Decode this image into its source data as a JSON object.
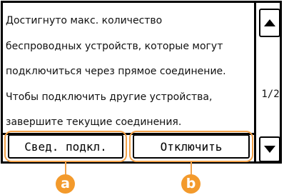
{
  "message": {
    "lines": [
      "Достигнуто макс. количество",
      "беспроводных устройств, которые могут",
      "подключиться через прямое соединение.",
      "Чтобы подключить другие устройства,",
      "завершите текущие соединения."
    ]
  },
  "pagination": {
    "indicator": "1/2"
  },
  "buttons": {
    "connection_info": "Свед. подкл.",
    "disconnect": "Отключить"
  },
  "callouts": {
    "a": "a",
    "b": "b"
  },
  "icons": {
    "scroll_up": "triangle-up-icon",
    "scroll_down": "triangle-down-icon"
  },
  "colors": {
    "highlight": "#f2a24a",
    "callout_fill": "#f39a2c"
  }
}
